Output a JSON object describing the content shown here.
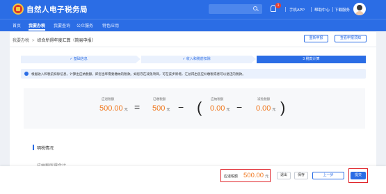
{
  "header": {
    "title": "自然人电子税务局",
    "links": [
      "手机APP",
      "帮助中心",
      "下载服务"
    ],
    "notification_count": "1"
  },
  "nav": {
    "items": [
      "首页",
      "我要办税",
      "我要查询",
      "公众服务",
      "特色应用"
    ],
    "active": "我要办税"
  },
  "breadcrumb": {
    "root": "我要办税",
    "separator": ">",
    "current": "综合所得年度汇算（简易申报）"
  },
  "actions": {
    "reset": "重新申报",
    "view_notice": "查看申报须知"
  },
  "steps": [
    {
      "label": "✓ 基础信息",
      "state": "done"
    },
    {
      "label": "✓ 收入和税前扣除",
      "state": "done"
    },
    {
      "label": "3 税款计算",
      "state": "active"
    }
  ],
  "notice": "根据收入和税前扣除信息，计算出应纳税额，即您当年需要缴纳的税款。如您存在减免项目，可在该步新增，汇总得出您应补缴税或者可以退还的税款。",
  "calculation": {
    "payable": {
      "label": "应退税额",
      "value": "500.00",
      "unit": "元"
    },
    "prepaid": {
      "label": "已缴税额",
      "value": "500",
      "unit": "元"
    },
    "taxable": {
      "label": "应纳税额",
      "value": "0.00",
      "unit": "元"
    },
    "reduction": {
      "label": "减免税额",
      "value": "0.00",
      "unit": "元"
    },
    "equals": "=",
    "minus": "−",
    "paren_open": "(",
    "paren_close": ")"
  },
  "section": {
    "title": "明税情况",
    "item": "应纳税所得合计"
  },
  "footer": {
    "tax_label": "应退税额",
    "tax_value": "500.00",
    "tax_unit": "元",
    "exit": "退出",
    "save": "保存",
    "prev": "上一步",
    "submit": "提交"
  },
  "colors": {
    "brand": "#2b6de5",
    "amount": "#f0761c",
    "highlight": "#e0242a"
  }
}
